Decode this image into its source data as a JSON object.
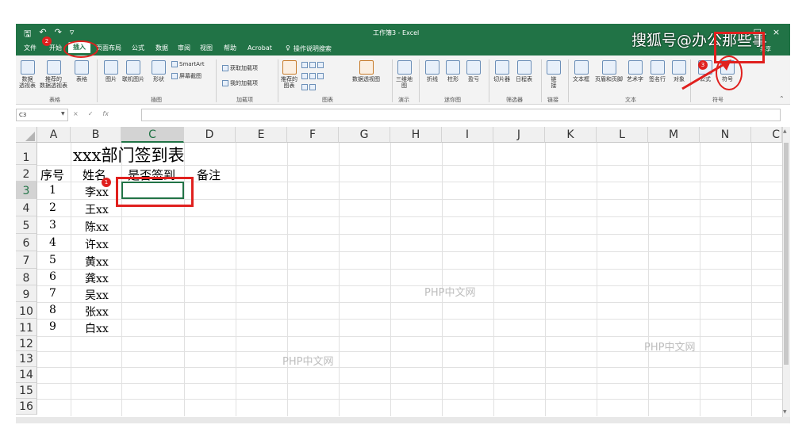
{
  "window": {
    "title": "工作簿3 - Excel",
    "tell_me": "操作说明搜索",
    "share": "共享",
    "qat_icons": [
      "save-icon",
      "undo-icon",
      "redo-icon",
      "customize-icon"
    ]
  },
  "tabs": [
    "文件",
    "开始",
    "插入",
    "页面布局",
    "公式",
    "数据",
    "审阅",
    "视图",
    "帮助",
    "Acrobat"
  ],
  "active_tab": "插入",
  "ribbon": {
    "groups": {
      "tables": "表格",
      "illustrations": "插图",
      "addins": "加载项",
      "charts": "图表",
      "tours": "演示",
      "sparklines": "迷你图",
      "filters": "筛选器",
      "links": "链接",
      "text": "文本",
      "symbols": "符号"
    },
    "buttons": {
      "pivot_line1": "数据",
      "pivot_line2": "透视表",
      "recommended_pivot_line1": "推荐的",
      "recommended_pivot_line2": "数据透视表",
      "table": "表格",
      "pictures": "图片",
      "online_pictures": "联机图片",
      "shapes": "形状",
      "smartart": "SmartArt",
      "screenshot": "屏幕截图",
      "get_addins": "获取加载项",
      "my_addins": "我的加载项",
      "recommended_charts_line1": "推荐的",
      "recommended_charts_line2": "图表",
      "pivot_chart": "数据透视图",
      "map_3d_line1": "三维地",
      "map_3d_line2": "图",
      "line": "折线",
      "column": "柱形",
      "win_loss": "盈亏",
      "slicer": "切片器",
      "timeline": "日程表",
      "link_line1": "链",
      "link_line2": "接",
      "textbox": "文本框",
      "header_footer": "页眉和页脚",
      "wordart": "艺术字",
      "signature": "签名行",
      "object": "对象",
      "equation": "公式",
      "symbol": "符号"
    }
  },
  "formula_bar": {
    "name_box": "C3",
    "cancel": "×",
    "enter": "✓",
    "fx": "fx",
    "value": ""
  },
  "columns": [
    "A",
    "B",
    "C",
    "D",
    "E",
    "F",
    "G",
    "H",
    "I",
    "J",
    "K",
    "L",
    "M",
    "N",
    "C"
  ],
  "rows": [
    "1",
    "2",
    "3",
    "4",
    "5",
    "6",
    "7",
    "8",
    "9",
    "10",
    "11",
    "12",
    "13",
    "14",
    "15",
    "16"
  ],
  "sheet": {
    "title": "xxx部门签到表",
    "headers": [
      "序号",
      "姓名",
      "是否签到",
      "备注"
    ],
    "records": [
      {
        "no": "1",
        "name": "李xx"
      },
      {
        "no": "2",
        "name": "王xx"
      },
      {
        "no": "3",
        "name": "陈xx"
      },
      {
        "no": "4",
        "name": "许xx"
      },
      {
        "no": "5",
        "name": "黄xx"
      },
      {
        "no": "6",
        "name": "龚xx"
      },
      {
        "no": "7",
        "name": "吴xx"
      },
      {
        "no": "8",
        "name": "张xx"
      },
      {
        "no": "9",
        "name": "白xx"
      }
    ]
  },
  "active_cell": "C3",
  "annotations": {
    "step1": "1",
    "step2": "2",
    "step3": "3",
    "accent": "#e0201e"
  },
  "watermarks": {
    "brand": "搜狐号@办公那些事",
    "site": "PHP中文网"
  },
  "theme": {
    "excel_green": "#217346"
  }
}
